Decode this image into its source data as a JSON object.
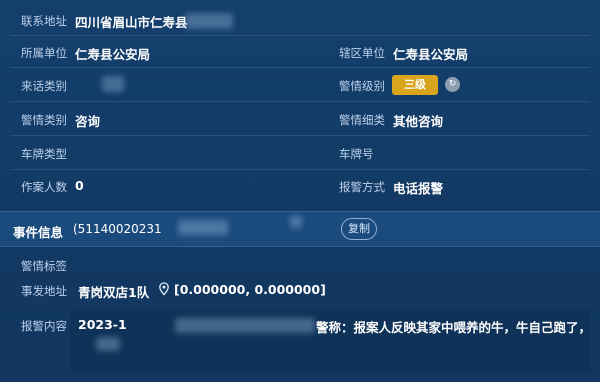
{
  "fields": {
    "contact_address": {
      "label": "联系地址",
      "value": "四川省眉山市仁寿县"
    },
    "belong_unit": {
      "label": "所属单位",
      "value": "仁寿县公安局"
    },
    "district_unit": {
      "label": "辖区单位",
      "value": "仁寿县公安局"
    },
    "call_type": {
      "label": "来话类别",
      "value": ""
    },
    "alarm_level": {
      "label": "警情级别",
      "value": "三级"
    },
    "alarm_category": {
      "label": "警情类别",
      "value": "咨询"
    },
    "alarm_subcategory": {
      "label": "警情细类",
      "value": "其他咨询"
    },
    "plate_type": {
      "label": "车牌类型",
      "value": ""
    },
    "plate_number": {
      "label": "车牌号",
      "value": ""
    },
    "case_people": {
      "label": "作案人数",
      "value": "0"
    },
    "report_method": {
      "label": "报警方式",
      "value": "电话报警"
    }
  },
  "event": {
    "title": "事件信息",
    "id": "(51140020231",
    "copy_label": "复制"
  },
  "event_fields": {
    "tags": {
      "label": "警情标签",
      "value": ""
    },
    "location": {
      "label": "事发地址",
      "value": "青岗双店1队",
      "coords": "[0.000000, 0.000000]"
    },
    "content": {
      "label": "报警内容",
      "date": "2023-1",
      "text": "警称：报案人反映其家中喂养的牛，牛自己跑了，"
    }
  },
  "icons": {
    "info": "info-icon",
    "location": "location-pin-icon"
  },
  "colors": {
    "background": "#123b66",
    "badge": "#d9a51d",
    "event_bar": "#1b4b7d"
  }
}
